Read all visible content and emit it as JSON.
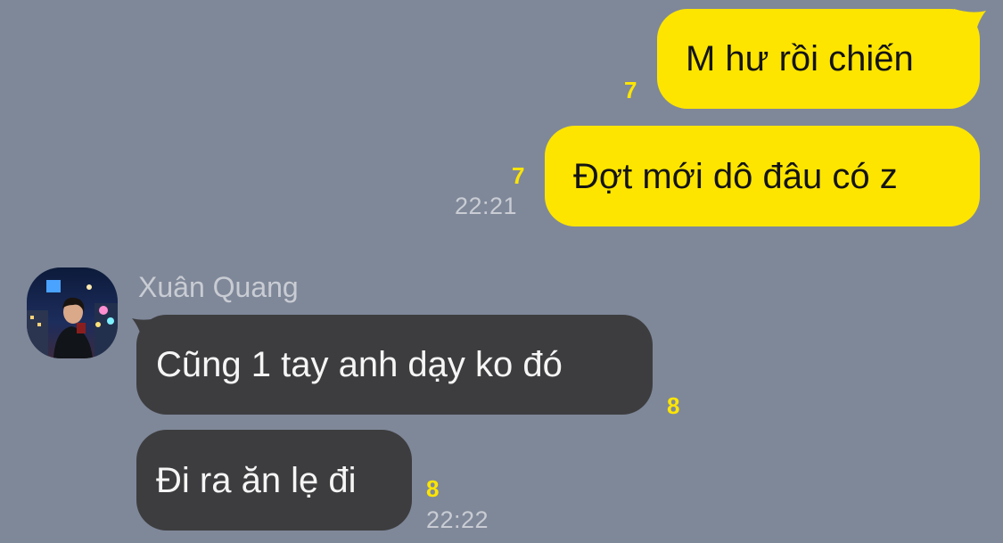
{
  "chat": {
    "messages": [
      {
        "direction": "outgoing",
        "text": "M hư rồi chiến",
        "unread_count": "7"
      },
      {
        "direction": "outgoing",
        "text": "Đợt mới dô đâu có z",
        "unread_count": "7",
        "time": "22:21"
      },
      {
        "direction": "incoming",
        "sender": "Xuân Quang",
        "text": "Cũng 1 tay anh dạy ko đó",
        "unread_count": "8"
      },
      {
        "direction": "incoming",
        "text": "Đi ra ăn lẹ đi",
        "unread_count": "8",
        "time": "22:22"
      }
    ]
  },
  "colors": {
    "background": "#7f8899",
    "outgoing_bubble": "#fee500",
    "incoming_bubble": "#3d3d3f",
    "unread_count": "#fee500",
    "meta_text": "#c9ccd3"
  },
  "icons": {
    "avatar": "profile-photo-night-city"
  }
}
